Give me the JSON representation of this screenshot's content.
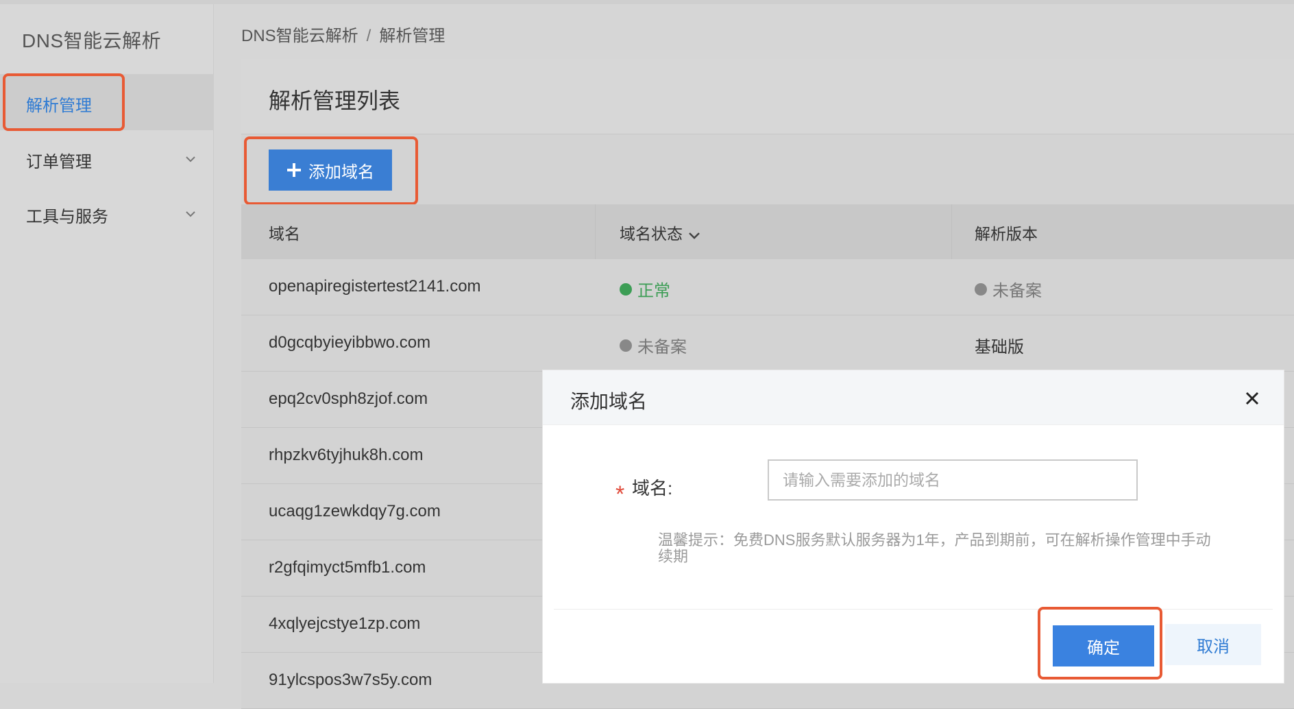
{
  "sidebar": {
    "title": "DNS智能云解析",
    "items": [
      {
        "label": "解析管理",
        "active": true
      },
      {
        "label": "订单管理",
        "has_children": true
      },
      {
        "label": "工具与服务",
        "has_children": true
      }
    ]
  },
  "breadcrumb": {
    "root": "DNS智能云解析",
    "separator": "/",
    "current": "解析管理"
  },
  "panel": {
    "title": "解析管理列表",
    "add_button_label": "添加域名"
  },
  "table": {
    "columns": [
      "域名",
      "域名状态",
      "解析版本"
    ],
    "rows": [
      {
        "domain": "openapiregistertest2141.com",
        "status": "正常",
        "status_color": "#3c9d55",
        "version": "未备案"
      },
      {
        "domain": "d0gcqbyieyibbwo.com",
        "status": "未备案",
        "status_color": "#888888",
        "version": "基础版"
      },
      {
        "domain": "epq2cv0sph8zjof.com"
      },
      {
        "domain": "rhpzkv6tyjhuk8h.com"
      },
      {
        "domain": "ucaqg1zewkdqy7g.com"
      },
      {
        "domain": "r2gfqimyct5mfb1.com"
      },
      {
        "domain": "4xqlyejcstye1zp.com"
      },
      {
        "domain": "91ylcspos3w7s5y.com"
      }
    ]
  },
  "modal": {
    "title": "添加域名",
    "field_label": "域名:",
    "required_mark": "*",
    "input_placeholder": "请输入需要添加的域名",
    "input_value": "",
    "hint": "温馨提示：免费DNS服务默认服务器为1年，产品到期前，可在解析操作管理中手动续期",
    "ok_label": "确定",
    "cancel_label": "取消"
  },
  "colors": {
    "accent": "#3a7ed3",
    "highlight": "#e85a34",
    "ok_status": "#3c9d55"
  }
}
